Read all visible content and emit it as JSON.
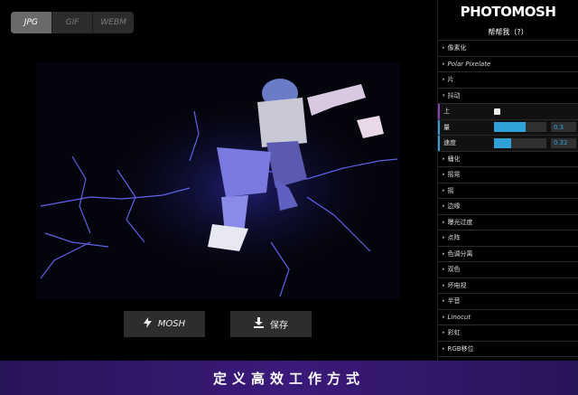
{
  "format_tabs": [
    "JPG",
    "GIF",
    "WEBM"
  ],
  "buttons": {
    "mosh": "MOSH",
    "save": "保存"
  },
  "panel": {
    "logo": "PHOTOMOSH",
    "help": "帮帮我（?）",
    "folders_top": [
      "像素化",
      "Polar Pixelate",
      "片",
      "抖动"
    ],
    "shake_controls": {
      "up_label": "上",
      "amount_label": "量",
      "amount_value": "0.3",
      "amount_fraction": 0.6,
      "speed_label": "速度",
      "speed_value": "0.32",
      "speed_fraction": 0.32
    },
    "folders_bottom": [
      "蛹化",
      "摇晃",
      "摇",
      "边缘",
      "曝光过度",
      "点阵",
      "色调分离",
      "双色",
      "坏电视",
      "半音",
      "Linocut",
      "彩虹",
      "RGB移位"
    ]
  },
  "banner": "定义高效工作方式",
  "icons": {
    "mosh": "lightning-icon",
    "save": "download-icon"
  },
  "colors": {
    "accent": "#2fa1d6",
    "banner": "#3a1a7a"
  }
}
